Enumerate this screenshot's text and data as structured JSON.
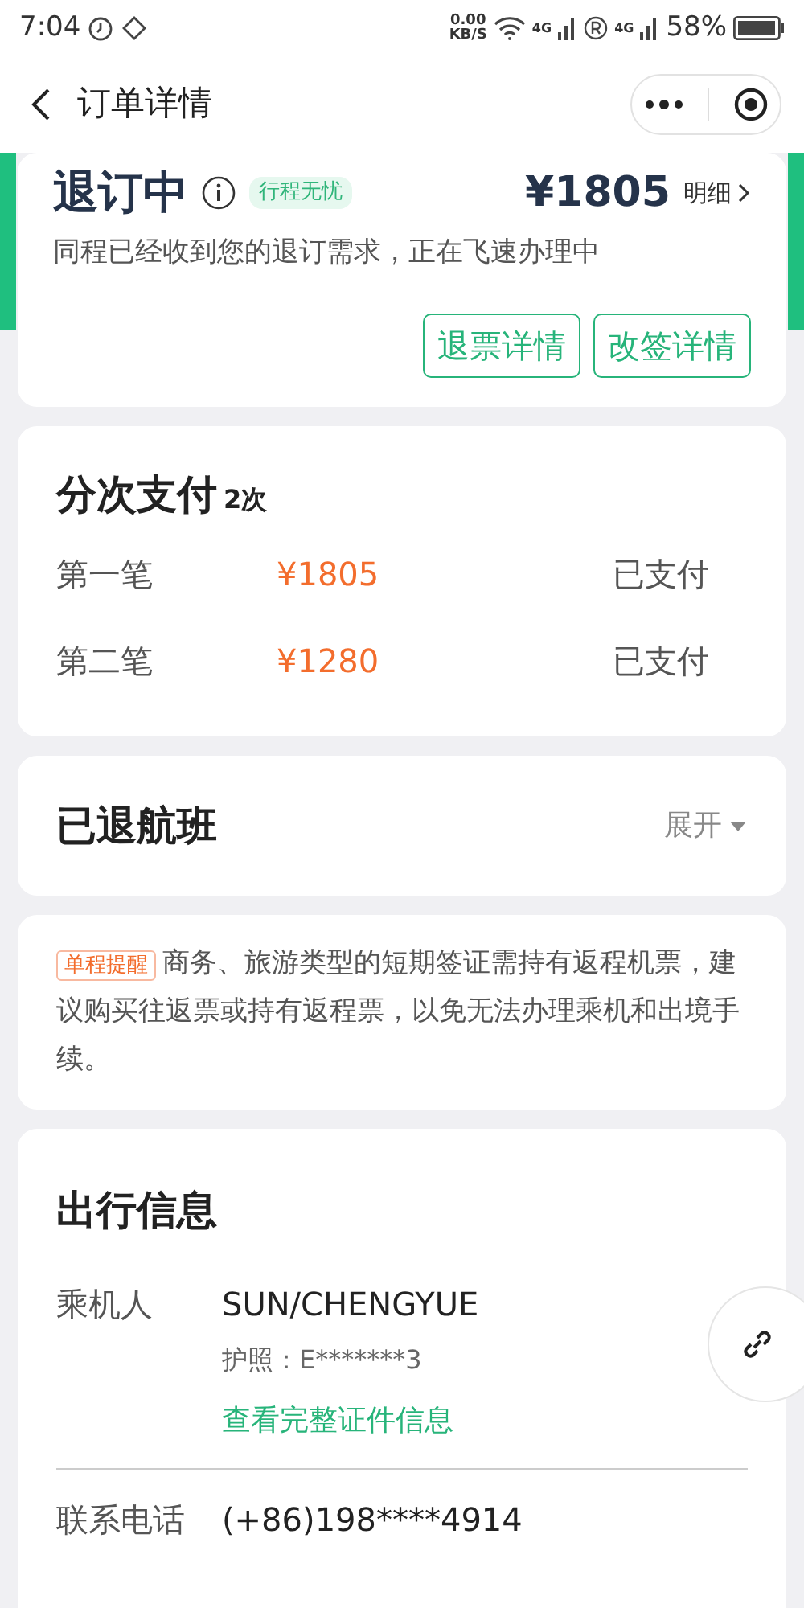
{
  "status_bar": {
    "time": "7:04",
    "net_speed": "0.00",
    "net_unit": "KB/S",
    "sim_labels": [
      "4G",
      "4G"
    ],
    "battery": "58%"
  },
  "header": {
    "title": "订单详情"
  },
  "refund_card": {
    "status": "退订中",
    "tag": "行程无忧",
    "price": "¥1805",
    "detail_link": "明细",
    "message": "同程已经收到您的退订需求，正在飞速办理中",
    "buttons": [
      "退票详情",
      "改签详情"
    ]
  },
  "installments": {
    "title": "分次支付",
    "count": "2次",
    "rows": [
      {
        "label": "第一笔",
        "amount": "¥1805",
        "status": "已支付"
      },
      {
        "label": "第二笔",
        "amount": "¥1280",
        "status": "已支付"
      }
    ]
  },
  "refunded_flights": {
    "title": "已退航班",
    "toggle": "展开",
    "expanded": false
  },
  "notice": {
    "tag": "单程提醒",
    "text": "商务、旅游类型的短期签证需持有返程机票，建议购买往返票或持有返程票，以免无法办理乘机和出境手续。"
  },
  "travel_info": {
    "title": "出行信息",
    "passenger_label": "乘机人",
    "passenger_name": "SUN/CHENGYUE",
    "passport": "护照：E*******3",
    "link": "查看完整证件信息",
    "phone_label": "联系电话",
    "phone": "(+86)198****4914"
  }
}
